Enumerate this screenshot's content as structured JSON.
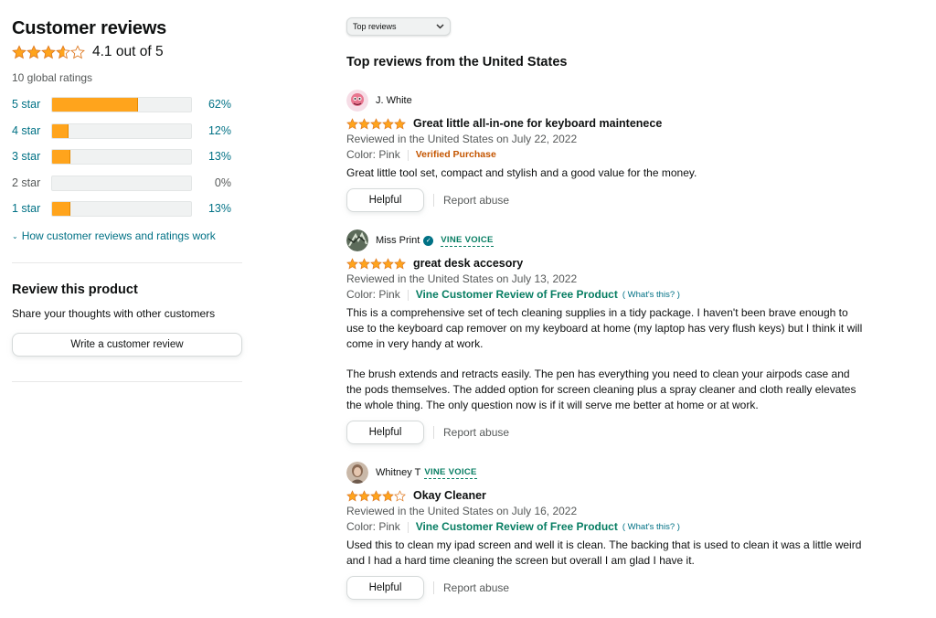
{
  "summary": {
    "title": "Customer reviews",
    "rating_value": 4.1,
    "rating_text": "4.1 out of 5",
    "global_ratings": "10 global ratings",
    "histogram": [
      {
        "label": "5 star",
        "percent": 62,
        "percent_text": "62%"
      },
      {
        "label": "4 star",
        "percent": 12,
        "percent_text": "12%"
      },
      {
        "label": "3 star",
        "percent": 13,
        "percent_text": "13%"
      },
      {
        "label": "2 star",
        "percent": 0,
        "percent_text": "0%"
      },
      {
        "label": "1 star",
        "percent": 13,
        "percent_text": "13%"
      }
    ],
    "how_link": "How customer reviews and ratings work"
  },
  "review_product": {
    "title": "Review this product",
    "subtitle": "Share your thoughts with other customers",
    "button_label": "Write a customer review"
  },
  "sort": {
    "selected": "Top reviews"
  },
  "reviews_heading": "Top reviews from the United States",
  "reviews": [
    {
      "author": "J. White",
      "vine_voice": false,
      "stars": 5,
      "title": "Great little all-in-one for keyboard maintenece",
      "date_text": "Reviewed in the United States on July 22, 2022",
      "color": "Color: Pink",
      "badge": "Verified Purchase",
      "body": [
        "Great little tool set, compact and stylish and a good value for the money."
      ],
      "helpful_label": "Helpful",
      "report_label": "Report abuse"
    },
    {
      "author": "Miss Print",
      "vine_voice": true,
      "vine_label": "VINE VOICE",
      "stars": 5,
      "title": "great desk accesory",
      "date_text": "Reviewed in the United States on July 13, 2022",
      "color": "Color: Pink",
      "badge": "Vine Customer Review of Free Product",
      "whats_this": "( What's this? )",
      "body": [
        "This is a comprehensive set of tech cleaning supplies in a tidy package. I haven't been brave enough to use to the keyboard cap remover on my keyboard at home (my laptop has very flush keys) but I think it will come in very handy at work.",
        "The brush extends and retracts easily. The pen has everything you need to clean your airpods case and the pods themselves. The added option for screen cleaning plus a spray cleaner and cloth really elevates the whole thing. The only question now is if it will serve me better at home or at work."
      ],
      "helpful_label": "Helpful",
      "report_label": "Report abuse"
    },
    {
      "author": "Whitney T",
      "vine_voice": true,
      "vine_label": "VINE VOICE",
      "stars": 4,
      "title": "Okay Cleaner",
      "date_text": "Reviewed in the United States on July 16, 2022",
      "color": "Color: Pink",
      "badge": "Vine Customer Review of Free Product",
      "whats_this": "( What's this? )",
      "body": [
        "Used this to clean my ipad screen and well it is clean. The backing that is used to clean it was a little weird and I had a hard time cleaning the screen but overall I am glad I have it."
      ],
      "helpful_label": "Helpful",
      "report_label": "Report abuse"
    }
  ],
  "colors": {
    "star": "#ffa41c",
    "link": "#007185",
    "vine": "#067d62",
    "verified": "#c45500"
  }
}
